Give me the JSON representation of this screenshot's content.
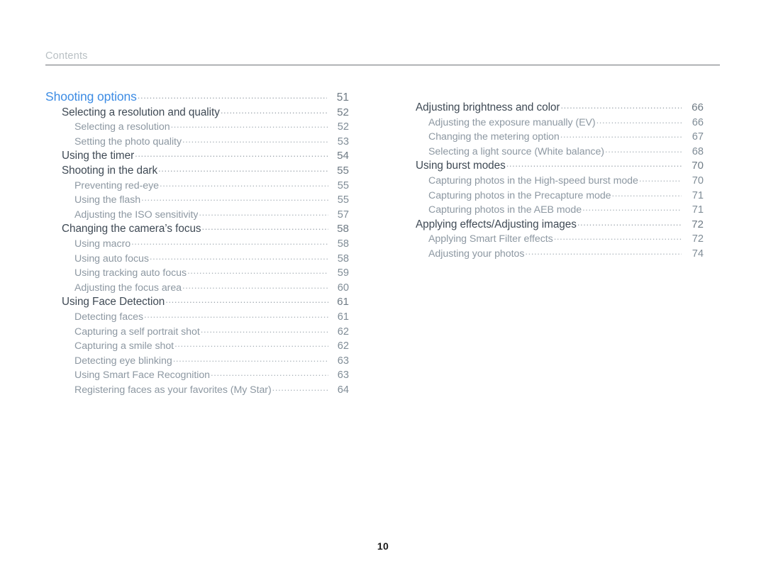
{
  "header": {
    "title": "Contents"
  },
  "footer": {
    "page_number": "10"
  },
  "colors": {
    "chapter_blue": "#3d8ce4",
    "section_dark": "#3f4a55",
    "subsection_gray": "#8d98a2",
    "header_gray": "#b9c0c4",
    "leader_gray": "#9aa3ab"
  },
  "columns": {
    "left": [
      {
        "level": 0,
        "label": "Shooting options",
        "page": "51"
      },
      {
        "level": 1,
        "label": "Selecting a resolution and quality",
        "page": "52"
      },
      {
        "level": 2,
        "label": "Selecting a resolution",
        "page": "52"
      },
      {
        "level": 2,
        "label": "Setting the photo quality",
        "page": "53"
      },
      {
        "level": 1,
        "label": "Using the timer",
        "page": "54"
      },
      {
        "level": 1,
        "label": "Shooting in the dark",
        "page": "55"
      },
      {
        "level": 2,
        "label": "Preventing red-eye",
        "page": "55"
      },
      {
        "level": 2,
        "label": "Using the flash",
        "page": "55"
      },
      {
        "level": 2,
        "label": "Adjusting the ISO sensitivity",
        "page": "57"
      },
      {
        "level": 1,
        "label": "Changing the camera’s focus",
        "page": "58"
      },
      {
        "level": 2,
        "label": "Using macro",
        "page": "58"
      },
      {
        "level": 2,
        "label": "Using auto focus",
        "page": "58"
      },
      {
        "level": 2,
        "label": "Using tracking auto focus",
        "page": "59"
      },
      {
        "level": 2,
        "label": "Adjusting the focus area",
        "page": "60"
      },
      {
        "level": 1,
        "label": "Using Face Detection",
        "page": "61"
      },
      {
        "level": 2,
        "label": "Detecting faces",
        "page": "61"
      },
      {
        "level": 2,
        "label": "Capturing a self portrait shot",
        "page": "62"
      },
      {
        "level": 2,
        "label": "Capturing a smile shot",
        "page": "62"
      },
      {
        "level": 2,
        "label": "Detecting eye blinking",
        "page": "63"
      },
      {
        "level": 2,
        "label": "Using Smart Face Recognition",
        "page": "63"
      },
      {
        "level": 2,
        "label": "Registering faces as your favorites (My Star)",
        "page": "64"
      }
    ],
    "right": [
      {
        "level": 1,
        "label": "Adjusting brightness and color",
        "page": "66"
      },
      {
        "level": 2,
        "label": "Adjusting the exposure manually (EV)",
        "page": "66"
      },
      {
        "level": 2,
        "label": "Changing the metering option",
        "page": "67"
      },
      {
        "level": 2,
        "label": "Selecting a light source (White balance)",
        "page": "68"
      },
      {
        "level": 1,
        "label": "Using burst modes",
        "page": "70"
      },
      {
        "level": 2,
        "label": "Capturing photos in the High-speed burst mode",
        "page": "70"
      },
      {
        "level": 2,
        "label": "Capturing photos in the Precapture mode",
        "page": "71"
      },
      {
        "level": 2,
        "label": "Capturing photos in the AEB mode",
        "page": "71"
      },
      {
        "level": 1,
        "label": "Applying effects/Adjusting images",
        "page": "72"
      },
      {
        "level": 2,
        "label": "Applying Smart Filter effects",
        "page": "72"
      },
      {
        "level": 2,
        "label": "Adjusting your photos",
        "page": "74"
      }
    ]
  }
}
